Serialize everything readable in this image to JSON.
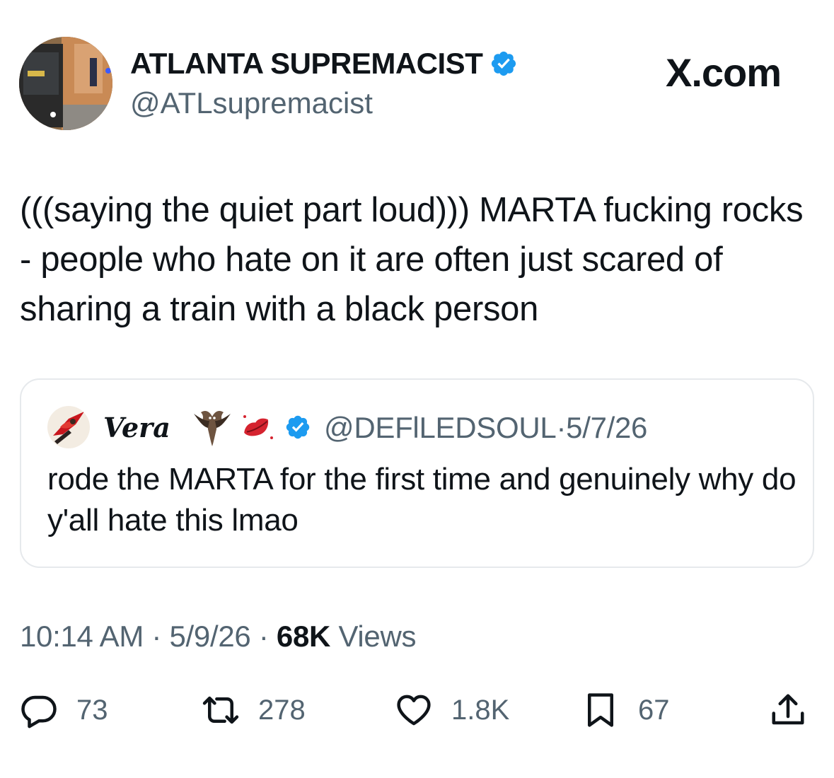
{
  "author": {
    "display_name": "ATLANTA SUPREMACIST",
    "handle": "@ATLsupremacist",
    "avatar_icon": "train-photo-avatar",
    "verified": true
  },
  "brand": "X.com",
  "tweet": {
    "text": "(((saying the quiet part loud))) MARTA fucking rocks - people who hate on it are often just scared of sharing a train with a black person"
  },
  "quoted_tweet": {
    "display_name": "Vera",
    "name_emojis": [
      "bat-emoji",
      "lips-emoji"
    ],
    "handle": "@DEFlLEDSOUL",
    "separator": "·",
    "date": "5/7/26",
    "text": "rode the MARTA for the first time and genuinely why do y'all hate this lmao"
  },
  "meta": {
    "time": "10:14 AM",
    "sep1": " · ",
    "date": "5/9/26",
    "sep2": " · ",
    "views_count": "68K",
    "views_label": " Views"
  },
  "actions": {
    "replies": "73",
    "reposts": "278",
    "likes": "1.8K",
    "bookmarks": "67"
  },
  "colors": {
    "verified_blue": "#1d9bf0",
    "secondary_text": "#536471",
    "primary_text": "#0f1419",
    "border": "#e6e9ec"
  }
}
